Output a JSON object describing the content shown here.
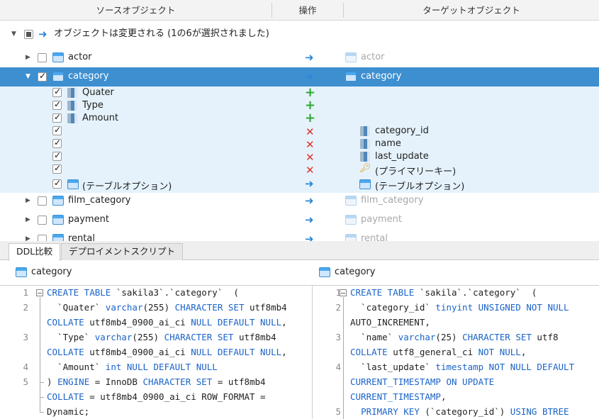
{
  "header": {
    "source_label": "ソースオブジェクト",
    "operation_label": "操作",
    "target_label": "ターゲットオブジェクト"
  },
  "summary": {
    "text": "オブジェクトは変更される (1の6が選択されました)"
  },
  "rows": {
    "actor": {
      "source": "actor",
      "target": "actor"
    },
    "category": {
      "source": "category",
      "target": "category"
    },
    "film_category": {
      "source": "film_category",
      "target": "film_category"
    },
    "payment": {
      "source": "payment",
      "target": "payment"
    },
    "rental": {
      "source": "rental",
      "target": "rental"
    }
  },
  "category_children": {
    "added": [
      "Quater",
      "Type",
      "Amount"
    ],
    "removed": [
      "category_id",
      "name",
      "last_update",
      "(プライマリーキー)"
    ],
    "table_options_source": "(テーブルオプション)",
    "table_options_target": "(テーブルオプション)"
  },
  "tabs": {
    "ddl_compare": "DDL比較",
    "deploy_script": "デプロイメントスクリプト"
  },
  "left_panel": {
    "title": "category",
    "line_numbers": [
      "1",
      "2",
      "3",
      "4",
      "5"
    ],
    "lines": [
      "CREATE TABLE `sakila3`.`category`  (",
      "  `Quater` varchar(255) CHARACTER SET utf8mb4",
      "COLLATE utf8mb4_0900_ai_ci NULL DEFAULT NULL,",
      "  `Type` varchar(255) CHARACTER SET utf8mb4",
      "COLLATE utf8mb4_0900_ai_ci NULL DEFAULT NULL,",
      "  `Amount` int NULL DEFAULT NULL",
      ") ENGINE = InnoDB CHARACTER SET = utf8mb4",
      "COLLATE = utf8mb4_0900_ai_ci ROW_FORMAT =",
      "Dynamic;"
    ]
  },
  "right_panel": {
    "title": "category",
    "line_numbers": [
      "1",
      "2",
      "3",
      "4",
      "5"
    ],
    "lines": [
      "CREATE TABLE `sakila`.`category`  (",
      "  `category_id` tinyint UNSIGNED NOT NULL",
      "AUTO_INCREMENT,",
      "  `name` varchar(25) CHARACTER SET utf8",
      "COLLATE utf8_general_ci NOT NULL,",
      "  `last_update` timestamp NOT NULL DEFAULT",
      "CURRENT_TIMESTAMP ON UPDATE",
      "CURRENT_TIMESTAMP,",
      "  PRIMARY KEY (`category_id`) USING BTREE"
    ]
  },
  "colors": {
    "selection": "#3e8fd0",
    "child_bg": "#e5f2fb",
    "keyword": "#1a63c9",
    "add": "#2ea82e",
    "remove": "#e0322b",
    "arrow": "#2b86d6"
  }
}
